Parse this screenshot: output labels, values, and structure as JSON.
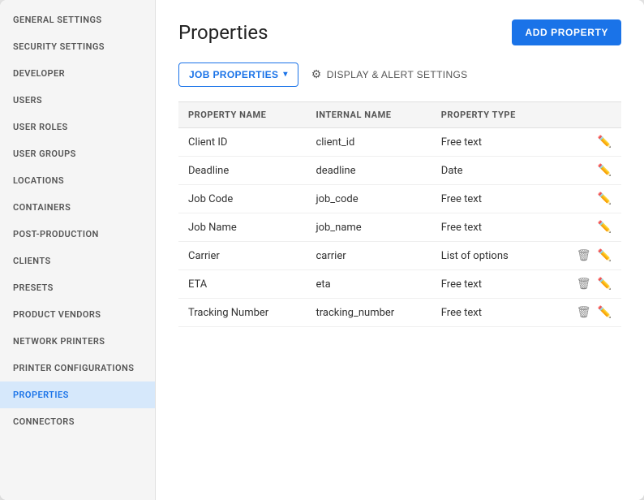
{
  "sidebar": {
    "items": [
      {
        "id": "general-settings",
        "label": "General Settings",
        "active": false
      },
      {
        "id": "security-settings",
        "label": "Security Settings",
        "active": false
      },
      {
        "id": "developer",
        "label": "Developer",
        "active": false
      },
      {
        "id": "users",
        "label": "Users",
        "active": false
      },
      {
        "id": "user-roles",
        "label": "User Roles",
        "active": false
      },
      {
        "id": "user-groups",
        "label": "User Groups",
        "active": false
      },
      {
        "id": "locations",
        "label": "Locations",
        "active": false
      },
      {
        "id": "containers",
        "label": "Containers",
        "active": false
      },
      {
        "id": "post-production",
        "label": "Post-Production",
        "active": false
      },
      {
        "id": "clients",
        "label": "Clients",
        "active": false
      },
      {
        "id": "presets",
        "label": "Presets",
        "active": false
      },
      {
        "id": "product-vendors",
        "label": "Product Vendors",
        "active": false
      },
      {
        "id": "network-printers",
        "label": "Network Printers",
        "active": false
      },
      {
        "id": "printer-configurations",
        "label": "Printer Configurations",
        "active": false
      },
      {
        "id": "properties",
        "label": "Properties",
        "active": true
      },
      {
        "id": "connectors",
        "label": "Connectors",
        "active": false
      }
    ]
  },
  "main": {
    "title": "Properties",
    "add_button_label": "ADD PROPERTY",
    "tab_job_properties": "JOB PROPERTIES",
    "tab_display_alert": "DISPLAY & ALERT SETTINGS",
    "table": {
      "headers": [
        "Property Name",
        "Internal Name",
        "Property Type"
      ],
      "rows": [
        {
          "property_name": "Client ID",
          "internal_name": "client_id",
          "property_type": "Free text",
          "has_delete": false
        },
        {
          "property_name": "Deadline",
          "internal_name": "deadline",
          "property_type": "Date",
          "has_delete": false
        },
        {
          "property_name": "Job Code",
          "internal_name": "job_code",
          "property_type": "Free text",
          "has_delete": false
        },
        {
          "property_name": "Job Name",
          "internal_name": "job_name",
          "property_type": "Free text",
          "has_delete": false
        },
        {
          "property_name": "Carrier",
          "internal_name": "carrier",
          "property_type": "List of options",
          "has_delete": true
        },
        {
          "property_name": "ETA",
          "internal_name": "eta",
          "property_type": "Free text",
          "has_delete": true
        },
        {
          "property_name": "Tracking Number",
          "internal_name": "tracking_number",
          "property_type": "Free text",
          "has_delete": true
        }
      ]
    }
  },
  "icons": {
    "edit": "✏️",
    "delete": "🗑",
    "settings": "⚙",
    "chevron_down": "▾"
  }
}
